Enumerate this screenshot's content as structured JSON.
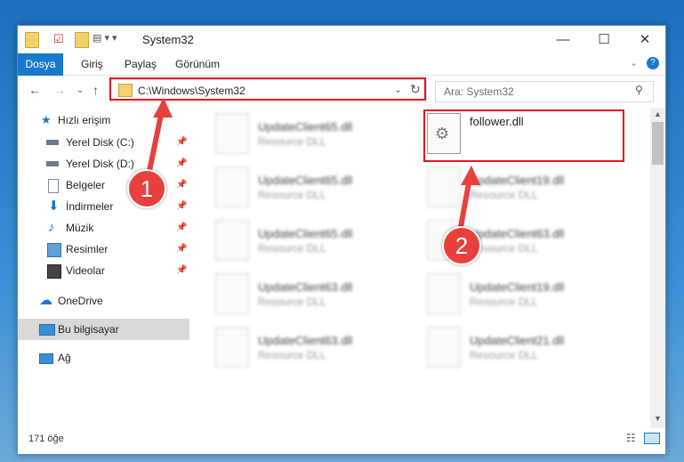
{
  "window": {
    "title": "System32"
  },
  "ribbon": {
    "tabs": [
      "Dosya",
      "Giriş",
      "Paylaş",
      "Görünüm"
    ]
  },
  "address": {
    "path": "C:\\Windows\\System32"
  },
  "search": {
    "placeholder": "Ara: System32"
  },
  "sidebar": {
    "quick_access": "Hızlı erişim",
    "items": [
      "Yerel Disk (C:)",
      "Yerel Disk (D:)",
      "Belgeler",
      "İndirmeler",
      "Müzik",
      "Resimler",
      "Videolar"
    ],
    "onedrive": "OneDrive",
    "this_pc": "Bu bilgisayar",
    "network": "Ağ"
  },
  "files": {
    "left": [
      {
        "name": "UpdateClient65.dll",
        "type": "Resource DLL"
      },
      {
        "name": "UpdateClient65.dll",
        "type": "Resource DLL"
      },
      {
        "name": "UpdateClient65.dll",
        "type": "Resource DLL"
      },
      {
        "name": "UpdateClient63.dll",
        "type": "Resource DLL"
      },
      {
        "name": "UpdateClient63.dll",
        "type": "Resource DLL"
      }
    ],
    "right_highlight": {
      "name": "follower.dll"
    },
    "right": [
      {
        "name": "UpdateClient19.dll",
        "type": "Resource DLL"
      },
      {
        "name": "UpdateClient63.dll",
        "type": "Resource DLL"
      },
      {
        "name": "UpdateClient19.dll",
        "type": "Resource DLL"
      },
      {
        "name": "UpdateClient21.dll",
        "type": "Resource DLL"
      }
    ]
  },
  "status": {
    "count": "171 öğe"
  },
  "annotations": {
    "step1": "1",
    "step2": "2"
  },
  "colors": {
    "accent": "#1979ca",
    "highlight": "#e0141e",
    "badge": "#e8403e"
  }
}
